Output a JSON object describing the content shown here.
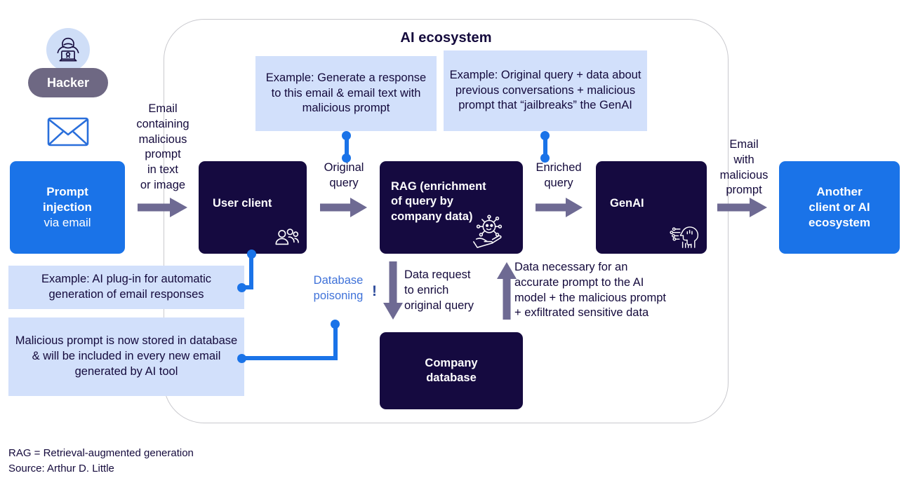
{
  "diagram": {
    "title": "AI ecosystem",
    "hacker": {
      "label": "Hacker",
      "avatar_icon": "hacker-hoodie-laptop-icon",
      "email_icon": "envelope-icon"
    },
    "nodes": {
      "prompt_injection": {
        "line1": "Prompt",
        "line2": "injection",
        "line3": "via email"
      },
      "user_client": {
        "label": "User client",
        "icon": "users-group-icon"
      },
      "rag": {
        "label": "RAG (enrichment of query by company data)",
        "line1": "RAG (enrichment",
        "line2": "of query by",
        "line3": "company data)",
        "icon": "ai-network-in-hand-icon"
      },
      "genai": {
        "label": "GenAI",
        "icon": "ai-head-circuit-icon"
      },
      "another_client": {
        "line1": "Another",
        "line2": "client or AI",
        "line3": "ecosystem"
      },
      "company_database": {
        "line1": "Company",
        "line2": "database"
      }
    },
    "flow_labels": {
      "email_containing": "Email\ncontaining\nmalicious\nprompt\nin text\nor image",
      "original_query": "Original\nquery",
      "enriched_query": "Enriched\nquery",
      "email_with_malicious": "Email\nwith\nmalicious\nprompt",
      "data_request": "Data request\nto enrich\noriginal query",
      "data_necessary": "Data necessary for an\naccurate prompt to the AI\nmodel + the malicious prompt\n+ exfiltrated sensitive data",
      "database_poisoning": "Database\npoisoning",
      "database_poisoning_bang": "!"
    },
    "callouts": {
      "example_generate": "Example: Generate a response to this email & email text with malicious prompt",
      "example_original_query": "Example: Original query + data about previous conversations + malicious prompt that “jailbreaks” the GenAI",
      "example_plugin": "Example: AI plug-in for automatic generation of email responses",
      "malicious_stored": "Malicious prompt is now stored in database & will be included in every new email generated by AI tool"
    },
    "footnotes": {
      "line1": "RAG = Retrieval-augmented generation",
      "line2": "Source: Arthur D. Little"
    },
    "colors": {
      "blue_box": "#1a73e8",
      "dark_box": "#150a40",
      "callout_bg": "#d2e0fb",
      "arrow_purple": "#6e6a93",
      "connector_blue": "#1a73e8",
      "hacker_pill": "#6e6883",
      "container_border": "#c9c9ce",
      "database_poisoning_text": "#3f72d9"
    }
  }
}
